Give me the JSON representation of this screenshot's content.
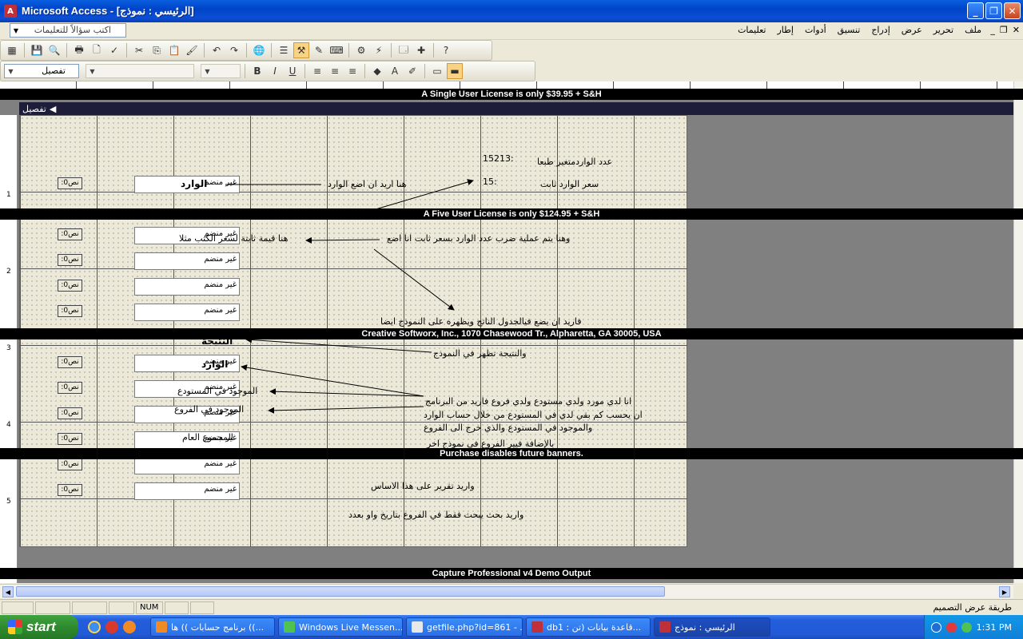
{
  "window": {
    "app": "Microsoft Access",
    "doc_title": "[الرئيسي : نموذج]"
  },
  "menubar": {
    "help_placeholder": "اكتب سؤالاً للتعليمات",
    "menus": [
      "ملف",
      "تحرير",
      "عرض",
      "إدراج",
      "تنسيق",
      "أدوات",
      "إطار",
      "تعليمات"
    ]
  },
  "toolbar2": {
    "object_combo": "تفصيل",
    "font_combo": "",
    "size_combo": ""
  },
  "section": {
    "label": "تفصيل"
  },
  "ruler": {
    "v_numbers": [
      "1",
      "2",
      "3",
      "4",
      "5"
    ]
  },
  "form": {
    "textbox_value": "غير منضم",
    "label_value": "نص0:",
    "notes": {
      "incoming_count": "عدد الواردمتغير طبعا",
      "incoming_count_val": ":15213",
      "fixed_price": "سعر الوارد ثابت",
      "fixed_price_val": ":15",
      "want_put_incoming": "هنا اريد ان اضع الوارد",
      "incoming_label": "الوارد",
      "multiply_note": "وهنا يتم عملية ضرب عدد الوارد بسعر ثابت انا اضع",
      "fixed_value": "هنا قيمة ثابتة لسعر الكتب مثلا",
      "save_table": "فاريد ان يضع فيالجدول الناتج ويظهره على النموذج ايضا",
      "result_box": "النتيجة",
      "result_shows": "والنتيجة تظهر في النموذج",
      "incoming2": "الوارد",
      "in_warehouse": "الموجود في المستودع",
      "in_branches": "الموجود في الفروع",
      "total": "المجموع العام",
      "supplier_note_1": "انا لدي مورد ولدي مستودع ولدي فروع فاريد من البرنامج",
      "supplier_note_2": "ان يحسب كم بقي لدي في المستودع من خلال حساب الوارد",
      "supplier_note_3": "والموجود في المستودع والذي خرج الى الفروع",
      "supplier_note_4": "بالإضافة فيير الفروع في نموذج اخر",
      "report_note": "واريد تقرير على هذا الاساس",
      "search_note": "واريد بحث يبحث فقط في الفروع بتاريخ واو بعدد"
    }
  },
  "banners": [
    "A Single User License is only $39.95 + S&H",
    "A Five User License is only $124.95 + S&H",
    "Creative Softworx, Inc., 1070 Chasewood Tr., Alpharetta, GA 30005, USA",
    "Purchase disables future banners.",
    "Capture Professional v4 Demo Output"
  ],
  "statusbar": {
    "num": "NUM",
    "mode": "طريقة عرض التصميم"
  },
  "taskbar": {
    "start": "start",
    "tasks": [
      "برنامج حسابات )) ها ((...",
      "Windows Live Messen...",
      "getfile.php?id=861 - ...",
      "db1 : قاعدة بيانات (تن...",
      "الرئيسي : نموذج"
    ],
    "clock": "1:31 PM"
  },
  "colors": {
    "titlebar": "#0a5fe0",
    "banner": "#000000",
    "grid_bg": "#ece9d8",
    "taskbar": "#245edc",
    "start": "#3fa33f"
  }
}
